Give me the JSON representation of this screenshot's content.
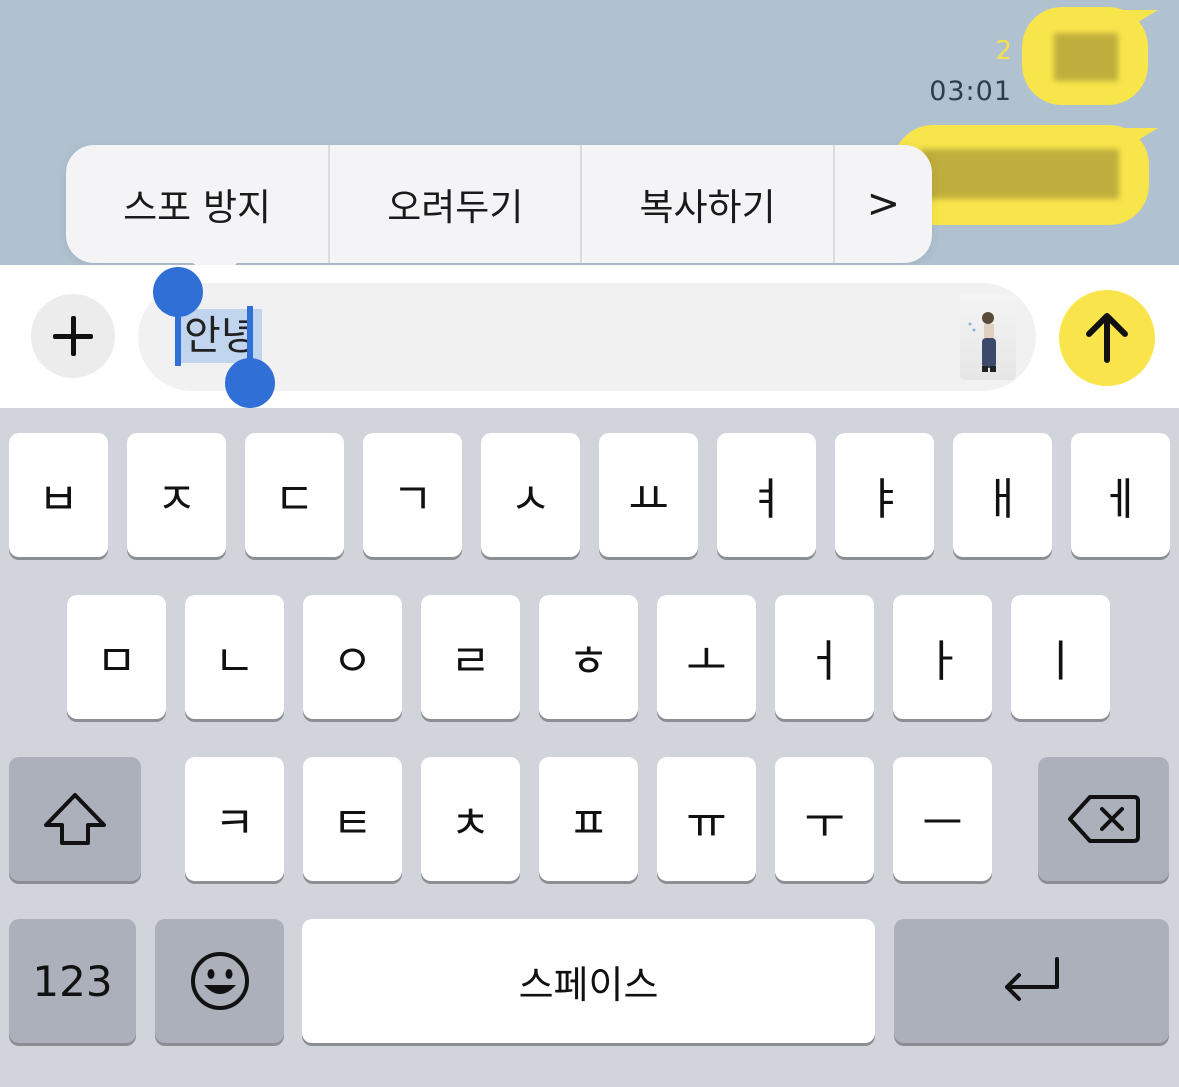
{
  "chat": {
    "unread_count": "2",
    "time": "03:01"
  },
  "context_menu": {
    "items": [
      "스포 방지",
      "오려두기",
      "복사하기",
      ">"
    ]
  },
  "input": {
    "selected_text": "안녕"
  },
  "keyboard": {
    "row1": [
      "ㅂ",
      "ㅈ",
      "ㄷ",
      "ㄱ",
      "ㅅ",
      "ㅛ",
      "ㅕ",
      "ㅑ",
      "ㅐ",
      "ㅔ"
    ],
    "row2": [
      "ㅁ",
      "ㄴ",
      "ㅇ",
      "ㄹ",
      "ㅎ",
      "ㅗ",
      "ㅓ",
      "ㅏ",
      "ㅣ"
    ],
    "row3": [
      "ㅋ",
      "ㅌ",
      "ㅊ",
      "ㅍ",
      "ㅠ",
      "ㅜ",
      "ㅡ"
    ],
    "numbers_label": "123",
    "space_label": "스페이스"
  },
  "icons": {
    "shift": "shift-icon",
    "backspace": "backspace-icon",
    "emoji": "emoji-icon",
    "return": "return-icon",
    "send": "arrow-up-icon",
    "attach": "plus-icon"
  },
  "colors": {
    "chat_bg": "#b0c1d0",
    "bubble": "#f8e54b",
    "selection_handle": "#2f6fd6",
    "keyboard_bg": "#d1d4da"
  }
}
